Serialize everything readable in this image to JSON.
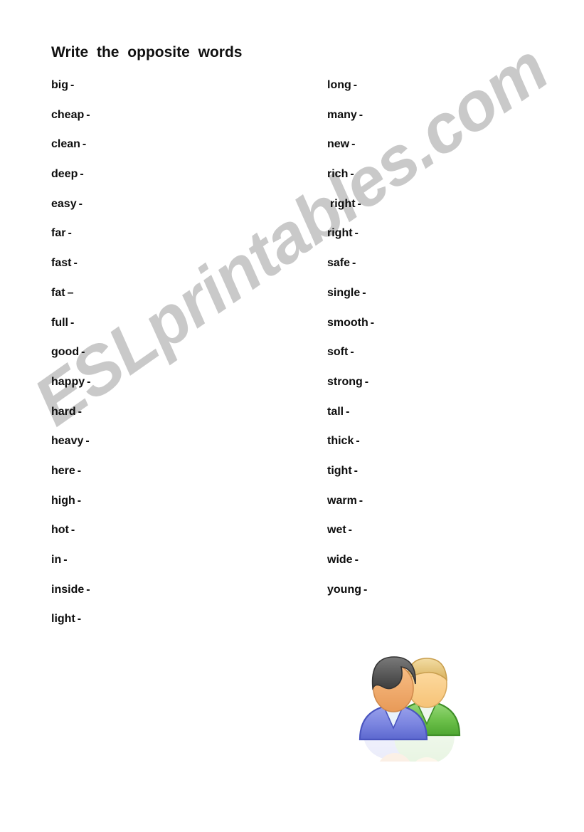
{
  "page": {
    "title": "Write  the  opposite  words",
    "background_color": "#ffffff",
    "text_color": "#0d0d0d"
  },
  "watermark": {
    "text": "ESLprintables.com",
    "color": "#c9c9c9",
    "rotation_degrees": -35
  },
  "columns": {
    "left": [
      {
        "term": "big",
        "dash": "-"
      },
      {
        "term": "cheap",
        "dash": "-"
      },
      {
        "term": "clean",
        "dash": "-"
      },
      {
        "term": "deep",
        "dash": "-"
      },
      {
        "term": "easy",
        "dash": "-"
      },
      {
        "term": "far",
        "dash": "-"
      },
      {
        "term": "fast",
        "dash": "-"
      },
      {
        "term": "fat",
        "dash": "–"
      },
      {
        "term": "full",
        "dash": "-"
      },
      {
        "term": "good",
        "dash": "-"
      },
      {
        "term": "happy",
        "dash": "-"
      },
      {
        "term": "hard",
        "dash": "-"
      },
      {
        "term": "heavy",
        "dash": "-"
      },
      {
        "term": "here",
        "dash": "-"
      },
      {
        "term": "high",
        "dash": "-"
      },
      {
        "term": "hot",
        "dash": "-"
      },
      {
        "term": "in",
        "dash": "-"
      },
      {
        "term": "inside",
        "dash": "-"
      },
      {
        "term": "light",
        "dash": "-"
      }
    ],
    "right": [
      {
        "term": "long",
        "dash": "-"
      },
      {
        "term": "many",
        "dash": "-"
      },
      {
        "term": "new",
        "dash": "-"
      },
      {
        "term": "rich",
        "dash": "-"
      },
      {
        "term": "right",
        "dash": "-",
        "indented": true
      },
      {
        "term": "right",
        "dash": "-"
      },
      {
        "term": "safe",
        "dash": "-"
      },
      {
        "term": "single",
        "dash": "-"
      },
      {
        "term": "smooth",
        "dash": "-"
      },
      {
        "term": "soft",
        "dash": "-"
      },
      {
        "term": "strong",
        "dash": "-"
      },
      {
        "term": "tall",
        "dash": "-"
      },
      {
        "term": "thick",
        "dash": "-"
      },
      {
        "term": "tight",
        "dash": "-"
      },
      {
        "term": "warm",
        "dash": "-"
      },
      {
        "term": "wet",
        "dash": "-"
      },
      {
        "term": "wide",
        "dash": "-"
      },
      {
        "term": "young",
        "dash": "-"
      }
    ]
  },
  "clipart": {
    "name": "two-people-icon",
    "colors": {
      "dark_hair": "#5a5a5a",
      "blonde_hair": "#e8c87a",
      "face_left": "#f0a868",
      "face_right": "#fbd08a",
      "body_left": "#7b85e0",
      "body_right": "#6cc04a",
      "collar": "#e8f2fb"
    }
  }
}
